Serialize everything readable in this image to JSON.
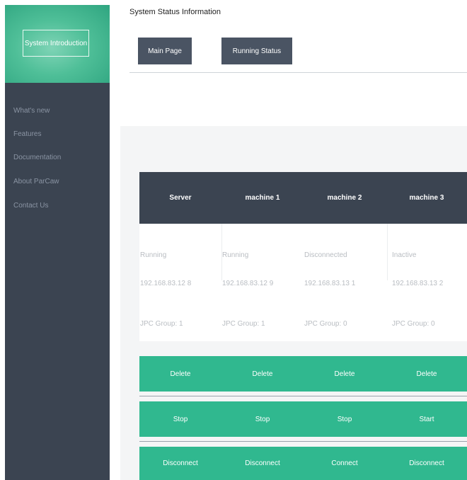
{
  "sidebar": {
    "intro_button": "System Introduction",
    "items": [
      "What's new",
      "Features",
      "Documentation",
      "About ParCaw",
      "Contact Us"
    ]
  },
  "header": {
    "title": "System Status Information",
    "main_page_button": "Main Page",
    "running_status_button": "Running Status"
  },
  "table": {
    "columns": [
      "Server",
      "machine 1",
      "machine 2",
      "machine 3"
    ],
    "status": [
      "Running",
      "Running",
      "Disconnected",
      "Inactive"
    ],
    "ip": [
      "192.168.83.12 8",
      "192.168.83.12 9",
      "192.168.83.13 1",
      "192.168.83.13 2"
    ],
    "group": [
      "JPC Group: 1",
      "JPC Group: 1",
      "JPC Group: 0",
      "JPC Group: 0"
    ]
  },
  "actions": {
    "delete": [
      "Delete",
      "Delete",
      "Delete",
      "Delete"
    ],
    "stop": [
      "Stop",
      "Stop",
      "Stop",
      "Start"
    ],
    "connect": [
      "Disconnect",
      "Disconnect",
      "Connect",
      "Disconnect"
    ]
  },
  "colors": {
    "sidebar": "#3b4451",
    "accent": "#30b88f",
    "button_dark": "#4a5463"
  }
}
